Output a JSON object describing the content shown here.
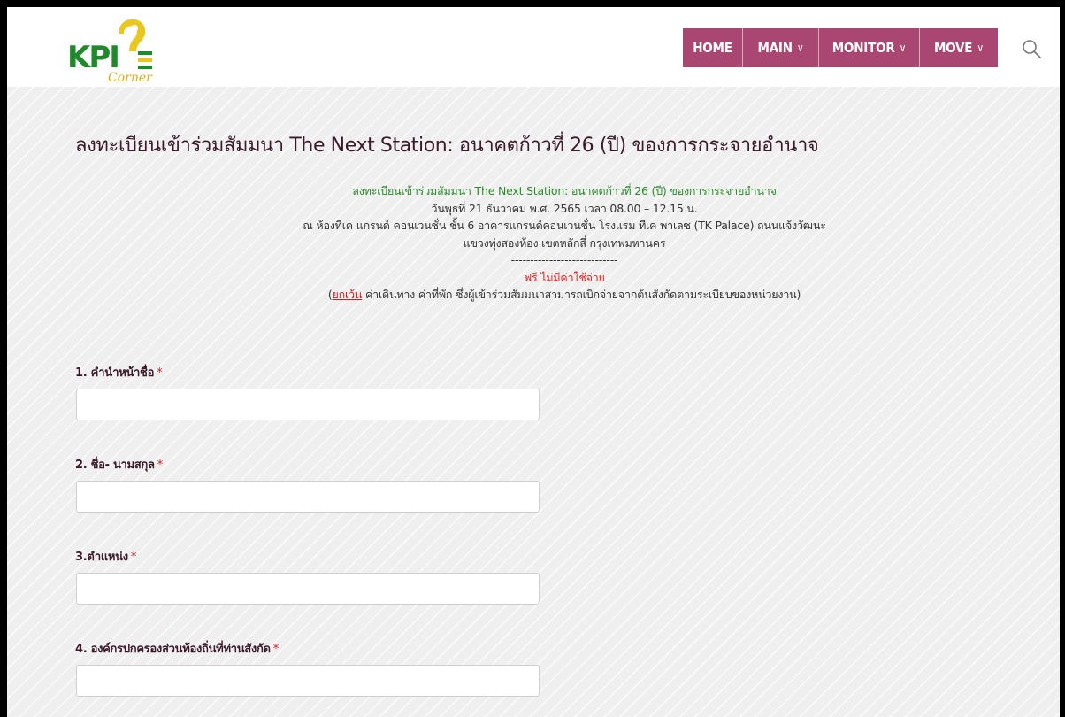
{
  "header": {
    "logo_text": "KPI",
    "logo_subtext": "Corner",
    "nav": [
      {
        "label": "HOME",
        "has_dropdown": false
      },
      {
        "label": "MAIN",
        "has_dropdown": true
      },
      {
        "label": "MONITOR",
        "has_dropdown": true
      },
      {
        "label": "MOVE",
        "has_dropdown": true
      }
    ],
    "chevron": "∨",
    "search_icon": "search-icon"
  },
  "page": {
    "title": "ลงทะเบียนเข้าร่วมสัมมนา The Next Station: อนาคตก้าวที่ 26 (ปี) ของการกระจายอำนาจ"
  },
  "intro": {
    "line1": "ลงทะเบียนเข้าร่วมสัมมนา The Next Station: อนาคตก้าวที่ 26 (ปี) ของการกระจายอำนาจ",
    "line2": "วันพุธที่ 21 ธันวาคม พ.ศ. 2565 เวลา 08.00 – 12.15 น.",
    "line3": "ณ ห้องทีเค แกรนด์ คอนเวนชั่น ชั้น 6 อาคารแกรนด์คอนเวนชั่น โรงแรม ทีเค พาเลซ (TK Palace) ถนนแจ้งวัฒนะ",
    "line4": "แขวงทุ่งสองห้อง เขตหลักสี่ กรุงเทพมหานคร",
    "divider": "----------------------------",
    "free": "ฟรี ไม่มีค่าใช้จ่าย",
    "except_open": "(",
    "except_link": "ยกเว้น",
    "except_rest": " ค่าเดินทาง ค่าที่พัก ซึ่งผู้เข้าร่วมสัมมนาสามารถเบิกจ่ายจากต้นสังกัดตามระเบียบของหน่วยงาน)"
  },
  "form": {
    "required_mark": "*",
    "fields": [
      {
        "label": "1. คำนำหน้าชื่อ",
        "value": ""
      },
      {
        "label": "2. ชื่อ- นามสกุล",
        "value": ""
      },
      {
        "label": "3.ตำแหน่ง",
        "value": ""
      },
      {
        "label": "4. องค์กรปกครองส่วนท้องถิ่นที่ท่านสังกัด",
        "value": ""
      }
    ]
  },
  "colors": {
    "nav_bg": "#a94672",
    "title": "#3b1a2a",
    "green": "#2e8b2e",
    "red": "#e02020",
    "logo_green": "#1f8a2a",
    "logo_yellow": "#e8c820"
  }
}
